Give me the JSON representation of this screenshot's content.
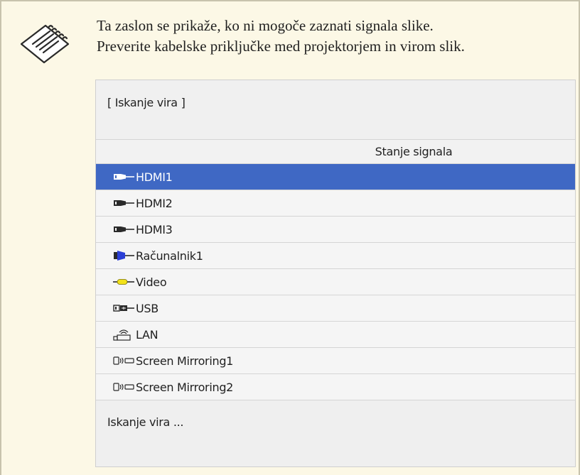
{
  "note": {
    "icon": "note-pencil-icon",
    "text_lines": [
      "Ta zaslon se prikaže, ko ni mogoče zaznati signala slike.",
      "Preverite kabelske priključke med projektorjem in virom slik."
    ]
  },
  "screen": {
    "title": "[ Iskanje vira ]",
    "column_header": "Stanje signala",
    "selected_index": 0,
    "sources": [
      {
        "label": "HDMI1",
        "icon": "hdmi-icon"
      },
      {
        "label": "HDMI2",
        "icon": "hdmi-icon"
      },
      {
        "label": "HDMI3",
        "icon": "hdmi-icon"
      },
      {
        "label": "Računalnik1",
        "icon": "vga-computer-icon"
      },
      {
        "label": "Video",
        "icon": "rca-video-icon"
      },
      {
        "label": "USB",
        "icon": "usb-icon"
      },
      {
        "label": "LAN",
        "icon": "lan-wireless-icon"
      },
      {
        "label": "Screen Mirroring1",
        "icon": "screen-mirroring-icon"
      },
      {
        "label": "Screen Mirroring2",
        "icon": "screen-mirroring-icon"
      }
    ],
    "footer": "Iskanje vira ..."
  },
  "colors": {
    "note_background": "#fcf8e6",
    "selection": "#3f68c4",
    "vga_blue": "#2b3fd6",
    "video_yellow": "#f2e21a"
  }
}
